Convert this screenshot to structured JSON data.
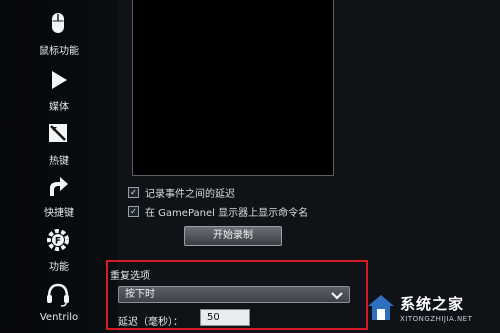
{
  "sidebar": {
    "items": [
      {
        "label": "鼠标功能",
        "icon": "mouse-icon"
      },
      {
        "label": "媒体",
        "icon": "play-icon"
      },
      {
        "label": "热键",
        "icon": "hotkey-icon"
      },
      {
        "label": "快捷键",
        "icon": "shortcut-arrow-icon"
      },
      {
        "label": "功能",
        "icon": "function-gear-icon"
      },
      {
        "label": "Ventrilo",
        "icon": "headset-icon"
      }
    ]
  },
  "recording": {
    "checkbox_delay_label": "记录事件之间的延迟",
    "checkbox_delay_checked": true,
    "checkbox_gamepanel_label": "在 GamePanel 显示器上显示命令名",
    "checkbox_gamepanel_checked": true,
    "start_button_label": "开始录制"
  },
  "repeat": {
    "title": "重复选项",
    "selected_option": "按下时",
    "delay_label": "延迟（毫秒）：",
    "delay_value": "50"
  },
  "watermark": {
    "brand": "系统之家",
    "url": "XITONGZHIJIA.NET"
  },
  "colors": {
    "highlight": "#d61b22",
    "background": "#0f1216"
  }
}
